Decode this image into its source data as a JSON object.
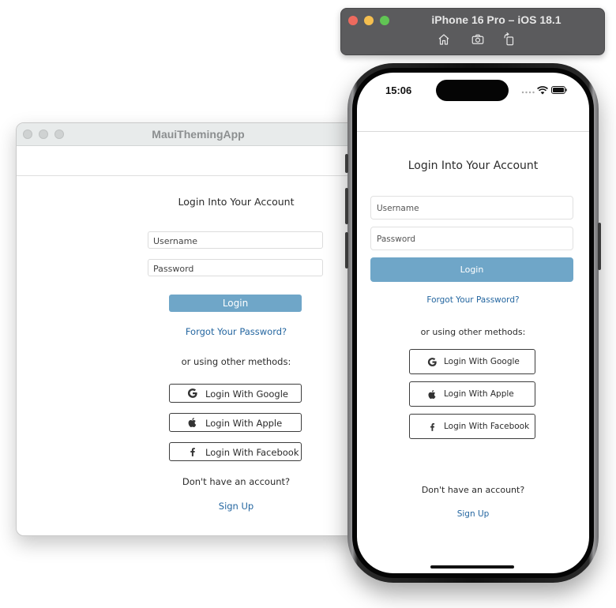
{
  "mac_window": {
    "title": "MauiThemingApp",
    "heading": "Login Into Your Account",
    "username_placeholder": "Username",
    "password_placeholder": "Password",
    "login_label": "Login",
    "forgot_label": "Forgot Your Password?",
    "other_methods": "or using other methods:",
    "social": [
      {
        "label": "Login With Google",
        "icon": "google-icon"
      },
      {
        "label": "Login With Apple",
        "icon": "apple-icon"
      },
      {
        "label": "Login With Facebook",
        "icon": "facebook-icon"
      }
    ],
    "no_account": "Don't have an account?",
    "signup_label": "Sign Up"
  },
  "simulator": {
    "title": "iPhone 16 Pro – iOS 18.1",
    "toolbar_icons": [
      "home-icon",
      "screenshot-icon",
      "rotate-icon"
    ]
  },
  "phone": {
    "time": "15:06",
    "heading": "Login Into Your Account",
    "username_placeholder": "Username",
    "password_placeholder": "Password",
    "login_label": "Login",
    "forgot_label": "Forgot Your Password?",
    "other_methods": "or using other methods:",
    "social": [
      {
        "label": "Login With Google",
        "icon": "google-icon"
      },
      {
        "label": "Login With Apple",
        "icon": "apple-icon"
      },
      {
        "label": "Login With Facebook",
        "icon": "facebook-icon"
      }
    ],
    "no_account": "Don't have an account?",
    "signup_label": "Sign Up"
  },
  "colors": {
    "accent": "#6fa6c8",
    "link": "#2466a0",
    "text": "#2b2b2b"
  }
}
